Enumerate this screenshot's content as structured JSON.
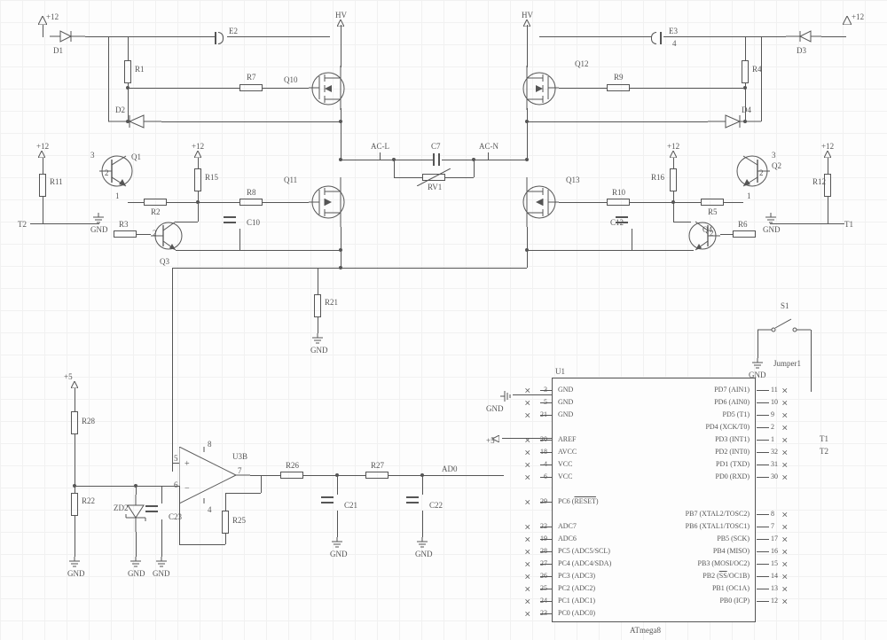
{
  "power": {
    "p12": "+12",
    "p5": "+5",
    "hv": "HV"
  },
  "nets": {
    "acl": "AC-L",
    "acn": "AC-N",
    "t1": "T1",
    "t2": "T2",
    "gnd": "GND",
    "ad0": "AD0",
    "jumper": "Jumper1"
  },
  "refs": {
    "D1": "D1",
    "D2": "D2",
    "D3": "D3",
    "D4": "D4",
    "E2": "E2",
    "E3": "E3",
    "R1": "R1",
    "R2": "R2",
    "R3": "R3",
    "R4": "R4",
    "R5": "R5",
    "R6": "R6",
    "R7": "R7",
    "R8": "R8",
    "R9": "R9",
    "R10": "R10",
    "R11": "R11",
    "R12": "R12",
    "R15": "R15",
    "R16": "R16",
    "R21": "R21",
    "R22": "R22",
    "R25": "R25",
    "R26": "R26",
    "R27": "R27",
    "R28": "R28",
    "C7": "C7",
    "C10": "C10",
    "C12": "C12",
    "C21": "C21",
    "C22": "C22",
    "C23": "C23",
    "RV1": "RV1",
    "Q1": "Q1",
    "Q2": "Q2",
    "Q3": "Q3",
    "Q4": "Q4",
    "Q10": "Q10",
    "Q11": "Q11",
    "Q12": "Q12",
    "Q13": "Q13",
    "ZD2": "ZD2",
    "U3B": "U3B",
    "U1": "U1",
    "S1": "S1"
  },
  "pinnums": {
    "n1": "1",
    "n2": "2",
    "n3": "3",
    "n4": "4",
    "n5": "5",
    "n6": "6",
    "n7": "7",
    "n8": "8"
  },
  "chip": {
    "name": "ATmega8",
    "left": [
      {
        "num": "3",
        "name": "GND"
      },
      {
        "num": "5",
        "name": "GND"
      },
      {
        "num": "21",
        "name": "GND"
      },
      {
        "num": "",
        "name": ""
      },
      {
        "num": "20",
        "name": "AREF"
      },
      {
        "num": "18",
        "name": "AVCC"
      },
      {
        "num": "4",
        "name": "VCC"
      },
      {
        "num": "6",
        "name": "VCC"
      },
      {
        "num": "",
        "name": ""
      },
      {
        "num": "29",
        "name": "PC6 (RESET)",
        "over": true
      },
      {
        "num": "",
        "name": ""
      },
      {
        "num": "22",
        "name": "ADC7"
      },
      {
        "num": "19",
        "name": "ADC6"
      },
      {
        "num": "28",
        "name": "PC5 (ADC5/SCL)"
      },
      {
        "num": "27",
        "name": "PC4 (ADC4/SDA)"
      },
      {
        "num": "26",
        "name": "PC3 (ADC3)"
      },
      {
        "num": "25",
        "name": "PC2 (ADC2)"
      },
      {
        "num": "24",
        "name": "PC1 (ADC1)"
      },
      {
        "num": "23",
        "name": "PC0 (ADC0)"
      }
    ],
    "right": [
      {
        "num": "11",
        "name": "PD7 (AIN1)"
      },
      {
        "num": "10",
        "name": "PD6 (AIN0)"
      },
      {
        "num": "9",
        "name": "PD5 (T1)"
      },
      {
        "num": "2",
        "name": "PD4 (XCK/T0)"
      },
      {
        "num": "1",
        "name": "PD3 (INT1)"
      },
      {
        "num": "32",
        "name": "PD2 (INT0)"
      },
      {
        "num": "31",
        "name": "PD1 (TXD)"
      },
      {
        "num": "30",
        "name": "PD0 (RXD)"
      },
      {
        "num": "",
        "name": ""
      },
      {
        "num": "8",
        "name": "PB7 (XTAL2/TOSC2)"
      },
      {
        "num": "7",
        "name": "PB6 (XTAL1/TOSC1)"
      },
      {
        "num": "17",
        "name": "PB5 (SCK)"
      },
      {
        "num": "16",
        "name": "PB4 (MISO)"
      },
      {
        "num": "15",
        "name": "PB3 (MOSI/OC2)"
      },
      {
        "num": "14",
        "name": "PB2 (SS/OC1B)",
        "over": true
      },
      {
        "num": "13",
        "name": "PB1 (OC1A)"
      },
      {
        "num": "12",
        "name": "PB0 (ICP)"
      }
    ]
  }
}
